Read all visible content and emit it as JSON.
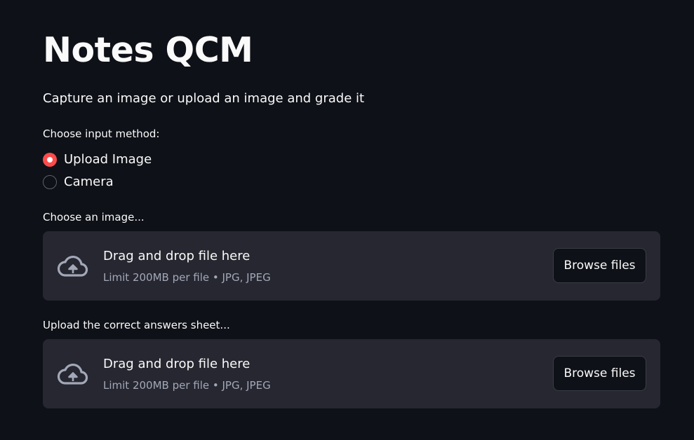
{
  "page": {
    "title": "Notes QCM",
    "subtitle": "Capture an image or upload an image and grade it"
  },
  "input_method": {
    "label": "Choose input method:",
    "options": [
      {
        "label": "Upload Image",
        "selected": true
      },
      {
        "label": "Camera",
        "selected": false
      }
    ]
  },
  "uploaders": [
    {
      "label": "Choose an image...",
      "drop_text": "Drag and drop file here",
      "limit_text": "Limit 200MB per file • JPG, JPEG",
      "button_label": "Browse files",
      "icon": "cloud-upload-icon"
    },
    {
      "label": "Upload the correct answers sheet...",
      "drop_text": "Drag and drop file here",
      "limit_text": "Limit 200MB per file • JPG, JPEG",
      "button_label": "Browse files",
      "icon": "cloud-upload-icon"
    }
  ],
  "colors": {
    "background": "#0e1117",
    "surface": "#262730",
    "accent": "#ff4b4b",
    "text": "#fafafa",
    "muted_text": "#a3a8b8"
  }
}
